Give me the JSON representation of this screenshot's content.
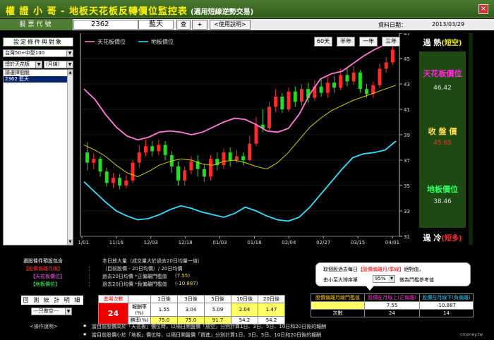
{
  "header": {
    "title": "權 證 小 哥  -  地板天花板反轉價位監控表",
    "subtitle": "(適用短線逆勢交易)",
    "close_glyph": "×"
  },
  "search": {
    "label": "股票代號",
    "code": "2362",
    "name": "藍天",
    "query_button": "查",
    "plus_button": "+",
    "help_button": "<使用說明>",
    "date_label": "資料日期：",
    "date": "2013/03/29"
  },
  "left": {
    "header": "設定條件與對象",
    "index_select": "台灣50+中型100",
    "filter_select": "總於天花板",
    "period_select": "(月線)",
    "list": [
      {
        "text": "請選擇個股"
      },
      {
        "text": "2362 藍天"
      }
    ]
  },
  "chart": {
    "legend": {
      "ceiling": "天花板價位",
      "floor": "地板價位"
    },
    "buttons": {
      "d60": "60天",
      "half": "半年",
      "y1": "一年",
      "y3": "三年"
    }
  },
  "chart_data": {
    "type": "candlestick",
    "title": "",
    "ylim": [
      31,
      47
    ],
    "y_ticks": [
      31,
      33,
      35,
      37,
      39,
      41,
      43,
      45,
      47
    ],
    "x_ticks": [
      "11/01",
      "11/16",
      "12/03",
      "12/18",
      "01/03",
      "01/18",
      "02/04",
      "02/27",
      "03/15",
      "04/01"
    ],
    "series": [
      {
        "name": "天花板價位",
        "color": "#ff7ad9",
        "values": [
          42.6,
          41.8,
          40.6,
          39.6,
          38.9,
          38.6,
          38.8,
          39.2,
          39.3,
          39.2,
          39.0,
          39.2,
          39.6,
          40.0,
          40.3,
          40.2,
          39.8,
          39.3,
          39.2,
          39.5,
          40.6,
          42.2,
          43.4,
          43.8,
          44.0,
          44.6,
          45.2,
          45.7,
          46.1,
          46.4
        ]
      },
      {
        "name": "地板價位",
        "color": "#33e0ff",
        "values": [
          35.3,
          34.5,
          33.7,
          33.0,
          32.6,
          32.3,
          32.4,
          32.7,
          33.1,
          33.4,
          33.2,
          32.9,
          32.7,
          32.5,
          32.8,
          33.3,
          33.0,
          32.6,
          32.3,
          32.2,
          32.5,
          33.3,
          34.3,
          35.3,
          36.3,
          37.2,
          37.5,
          37.6,
          37.8,
          38.5
        ]
      },
      {
        "name": "MA",
        "color": "#cfd000",
        "values": [
          38.2,
          37.8,
          37.3,
          36.6,
          36.0,
          35.7,
          36.1,
          36.6,
          36.9,
          37.1,
          37.0,
          36.7,
          36.6,
          36.9,
          37.0,
          36.8,
          36.5,
          36.3,
          36.8,
          37.6,
          38.6,
          39.6,
          40.3,
          40.9,
          41.3,
          41.7,
          42.0,
          42.3,
          42.6,
          42.9
        ]
      }
    ],
    "candles": [
      [
        37.6,
        36.8,
        38.4,
        36.2
      ],
      [
        36.8,
        37.1,
        37.5,
        36.3
      ],
      [
        37.1,
        36.1,
        37.3,
        35.7
      ],
      [
        36.1,
        35.2,
        36.4,
        34.9
      ],
      [
        35.2,
        35.6,
        36.0,
        34.8
      ],
      [
        35.6,
        35.0,
        35.9,
        34.7
      ],
      [
        35.0,
        35.4,
        35.8,
        34.8
      ],
      [
        35.4,
        36.8,
        37.0,
        35.2
      ],
      [
        36.8,
        37.6,
        38.2,
        36.4
      ],
      [
        37.6,
        38.1,
        38.6,
        37.3
      ],
      [
        38.1,
        37.7,
        38.5,
        37.3
      ],
      [
        37.7,
        38.2,
        38.6,
        37.4
      ],
      [
        38.2,
        37.4,
        38.5,
        37.0
      ],
      [
        37.4,
        36.5,
        37.7,
        36.0
      ],
      [
        36.5,
        35.4,
        36.9,
        35.0
      ],
      [
        35.4,
        36.2,
        36.5,
        35.0
      ],
      [
        36.2,
        36.9,
        37.3,
        35.9
      ],
      [
        36.9,
        36.3,
        37.4,
        35.7
      ],
      [
        36.3,
        35.7,
        36.7,
        35.3
      ],
      [
        35.7,
        37.1,
        37.4,
        35.4
      ],
      [
        37.1,
        36.6,
        37.6,
        36.2
      ],
      [
        36.6,
        37.6,
        37.9,
        36.3
      ],
      [
        37.6,
        37.0,
        38.0,
        36.5
      ],
      [
        37.0,
        37.3,
        37.8,
        36.8
      ],
      [
        37.3,
        37.0,
        37.6,
        36.6
      ],
      [
        37.0,
        38.3,
        38.9,
        36.9
      ],
      [
        38.3,
        39.8,
        40.4,
        38.1
      ],
      [
        39.8,
        39.5,
        41.0,
        39.2
      ],
      [
        39.5,
        41.2,
        41.6,
        39.4
      ],
      [
        41.2,
        42.0,
        42.6,
        40.8
      ],
      [
        42.0,
        41.0,
        42.3,
        40.7
      ],
      [
        41.0,
        42.4,
        42.7,
        40.8
      ],
      [
        42.4,
        41.6,
        42.8,
        41.2
      ],
      [
        41.6,
        42.6,
        43.0,
        41.3
      ],
      [
        42.6,
        41.9,
        43.1,
        41.5
      ],
      [
        41.9,
        42.8,
        43.3,
        41.7
      ],
      [
        42.8,
        42.3,
        43.4,
        42.0
      ],
      [
        42.3,
        43.1,
        43.6,
        41.9
      ],
      [
        43.1,
        42.7,
        43.6,
        42.3
      ],
      [
        42.7,
        43.7,
        44.2,
        42.5
      ],
      [
        43.7,
        43.2,
        44.3,
        42.8
      ],
      [
        43.2,
        43.9,
        44.4,
        42.9
      ],
      [
        43.9,
        42.6,
        44.1,
        42.3
      ],
      [
        42.6,
        42.2,
        43.0,
        41.9
      ],
      [
        42.2,
        42.9,
        43.2,
        41.9
      ],
      [
        42.9,
        44.2,
        44.6,
        42.7
      ],
      [
        44.2,
        44.7,
        45.1,
        43.9
      ],
      [
        44.7,
        45.7,
        46.2,
        44.5
      ]
    ]
  },
  "right": {
    "hot": "過 熱",
    "hot_sub": "(短空)",
    "ceiling_label": "天花板價位",
    "ceiling_value": "46.42",
    "close_label": "收 盤 價",
    "close_value": "45.65",
    "floor_label": "地板價位",
    "floor_value": "38.46",
    "cold": "過 冷",
    "cold_sub": "(短多)"
  },
  "bottom": {
    "cond_title": "選股條件預設包含",
    "cond1": "本日放大量（成交量大於過去20日均量一倍）",
    "cond_left1": "【股價偏離月線】",
    "bullet": "：",
    "cond2": "（目前股價 - 20日均價）/  20日均價",
    "cond_left2": "【天花板價位】",
    "cond3": "過去20日均價 *正偏離門檻值",
    "cond3v": "(7.55)",
    "cond_left3": "【地板價位】",
    "cond4": "過去20日均價 *負偏離門檻值",
    "cond4v": "(-10.887)",
    "stat_head": "回 測 統 計 明 細",
    "stat_select": "---只做空---",
    "table": {
      "count_head": "進場次數",
      "count": "24",
      "cols": [
        "1日後",
        "3日後",
        "5日後",
        "10日後",
        "20日後"
      ],
      "rows": [
        {
          "label": "報酬率(%)",
          "values": [
            "1.55",
            "3.04",
            "5.09",
            "2.04",
            "1.47"
          ]
        },
        {
          "label": "勝率(%)",
          "values": [
            "75.0",
            "75.0",
            "91.7",
            "54.2",
            "54.2"
          ]
        }
      ]
    },
    "callout": {
      "line1_a": "取個股過去每日",
      "line1_b": "【股價偏離月/季線】",
      "line1_c": "絕對值，",
      "line2_a": "由小至大排序第",
      "pct": "95%",
      "line2_b": "做為門檻參考值"
    },
    "thr": {
      "h1": "股價偏離月線門檻值",
      "h2": "股價在月線上(正偏離)",
      "h3": "股價在月線下(負偏離)",
      "r1": [
        "",
        "7.55",
        "-10.887"
      ],
      "r2": [
        "次數",
        "24",
        "14"
      ]
    },
    "op_label": "<操作說明>",
    "star": "★",
    "op1": "當目前股價高於「天花板」價位時，以隔日開盤價「放空」分別計算1日、3日、5日、10日和20日後的報酬",
    "op2": "當目前股價小於「地板」價位時，以隔日開盤價「買進」分別計算1日、3日、5日、10日和20日後的報酬",
    "watermark": "cmoney.tw"
  }
}
